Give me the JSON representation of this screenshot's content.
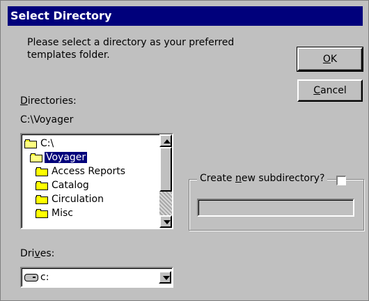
{
  "window": {
    "title": "Select Directory"
  },
  "prompt": {
    "line1": "Please select a directory as your preferred",
    "line2": "templates folder."
  },
  "buttons": {
    "ok": {
      "mnemonic": "O",
      "rest": "K"
    },
    "cancel": {
      "mnemonic": "C",
      "rest": "ancel"
    }
  },
  "directories": {
    "label_mnemonic": "D",
    "label_rest": "irectories:",
    "current_path": "C:\\Voyager",
    "items": [
      {
        "label": "C:\\",
        "icon": "folder-open-icon",
        "indent": 0,
        "selected": false
      },
      {
        "label": "Voyager",
        "icon": "folder-open-icon",
        "indent": 1,
        "selected": true
      },
      {
        "label": "Access Reports",
        "icon": "folder-icon",
        "indent": 2,
        "selected": false
      },
      {
        "label": "Catalog",
        "icon": "folder-icon",
        "indent": 2,
        "selected": false
      },
      {
        "label": "Circulation",
        "icon": "folder-icon",
        "indent": 2,
        "selected": false
      },
      {
        "label": "Misc",
        "icon": "folder-icon",
        "indent": 2,
        "selected": false
      }
    ]
  },
  "subdirectory": {
    "label_pre": "Create ",
    "label_mnemonic": "n",
    "label_post": "ew subdirectory?",
    "checked": false,
    "value": ""
  },
  "drives": {
    "label_pre": "Dri",
    "label_mnemonic": "v",
    "label_post": "es:",
    "selected": "c:"
  },
  "colors": {
    "titlebar": "#00007b",
    "face": "#c0c0c0",
    "selection": "#00007b"
  }
}
